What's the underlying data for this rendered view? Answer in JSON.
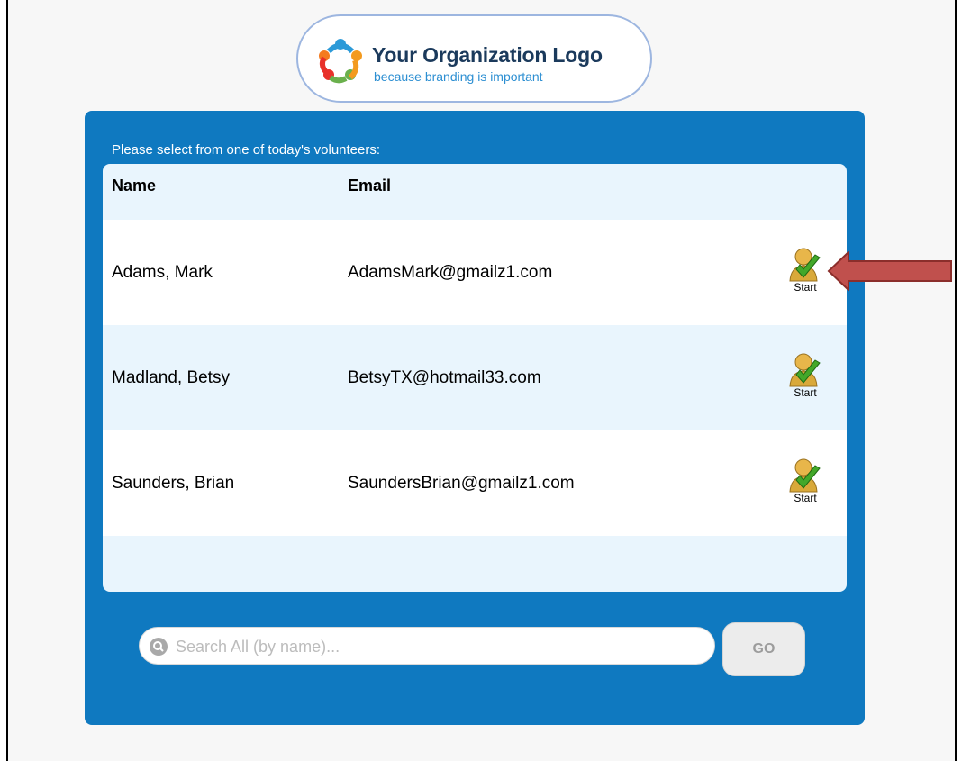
{
  "logo": {
    "title": "Your Organization Logo",
    "subtitle": "because branding is important"
  },
  "panel": {
    "prompt": "Please select from one of today's volunteers:"
  },
  "table": {
    "headers": {
      "name": "Name",
      "email": "Email"
    },
    "rows": [
      {
        "name": "Adams, Mark",
        "email": "AdamsMark@gmailz1.com",
        "action": "Start"
      },
      {
        "name": "Madland, Betsy",
        "email": "BetsyTX@hotmail33.com",
        "action": "Start"
      },
      {
        "name": "Saunders, Brian",
        "email": "SaundersBrian@gmailz1.com",
        "action": "Start"
      }
    ]
  },
  "search": {
    "placeholder": "Search All (by name)...",
    "go_label": "GO"
  },
  "annotation": {
    "icon": "arrow-left-icon",
    "color": "#c0504d"
  },
  "colors": {
    "panel": "#0f79c0",
    "table_alt": "#e9f5fd",
    "accent": "#2d8fd2"
  }
}
